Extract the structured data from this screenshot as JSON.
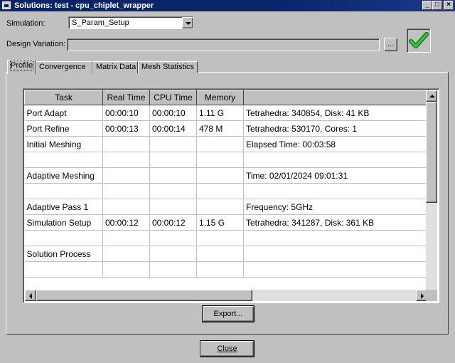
{
  "window": {
    "title": "Solutions: test - cpu_chiplet_wrapper",
    "minimize_glyph": "_",
    "maximize_glyph": "□",
    "close_glyph": "×"
  },
  "simulation": {
    "label": "Simulation:",
    "value": "S_Param_Setup"
  },
  "design_variation": {
    "label": "Design Variation:",
    "value": "",
    "browse_label": "..."
  },
  "status": {
    "icon": "checkmark-icon",
    "color": "#22b022"
  },
  "tabs": [
    {
      "label": "Profile",
      "active": true
    },
    {
      "label": "Convergence",
      "active": false
    },
    {
      "label": "Matrix Data",
      "active": false
    },
    {
      "label": "Mesh Statistics",
      "active": false
    }
  ],
  "table": {
    "columns": [
      "Task",
      "Real Time",
      "CPU Time",
      "Memory",
      ""
    ],
    "rows": [
      [
        "Port Adapt",
        "00:00:10",
        "00:00:10",
        "1.11 G",
        "Tetrahedra: 340854, Disk: 41 KB"
      ],
      [
        "Port Refine",
        "00:00:13",
        "00:00:14",
        "478 M",
        "Tetrahedra: 530170, Cores: 1"
      ],
      [
        "Initial Meshing",
        "",
        "",
        "",
        "Elapsed Time: 00:03:58"
      ],
      [
        "",
        "",
        "",
        "",
        ""
      ],
      [
        "Adaptive Meshing",
        "",
        "",
        "",
        "Time: 02/01/2024 09:01:31"
      ],
      [
        "",
        "",
        "",
        "",
        ""
      ],
      [
        "Adaptive Pass 1",
        "",
        "",
        "",
        "Frequency: 5GHz"
      ],
      [
        "Simulation Setup",
        "00:00:12",
        "00:00:12",
        "1.15 G",
        "Tetrahedra: 341287, Disk: 361 KB"
      ],
      [
        "",
        "",
        "",
        "",
        ""
      ],
      [
        "Solution Process",
        "",
        "",
        "",
        ""
      ],
      [
        "",
        "",
        "",
        "",
        ""
      ]
    ]
  },
  "buttons": {
    "export": "Export...",
    "close": "Close"
  }
}
